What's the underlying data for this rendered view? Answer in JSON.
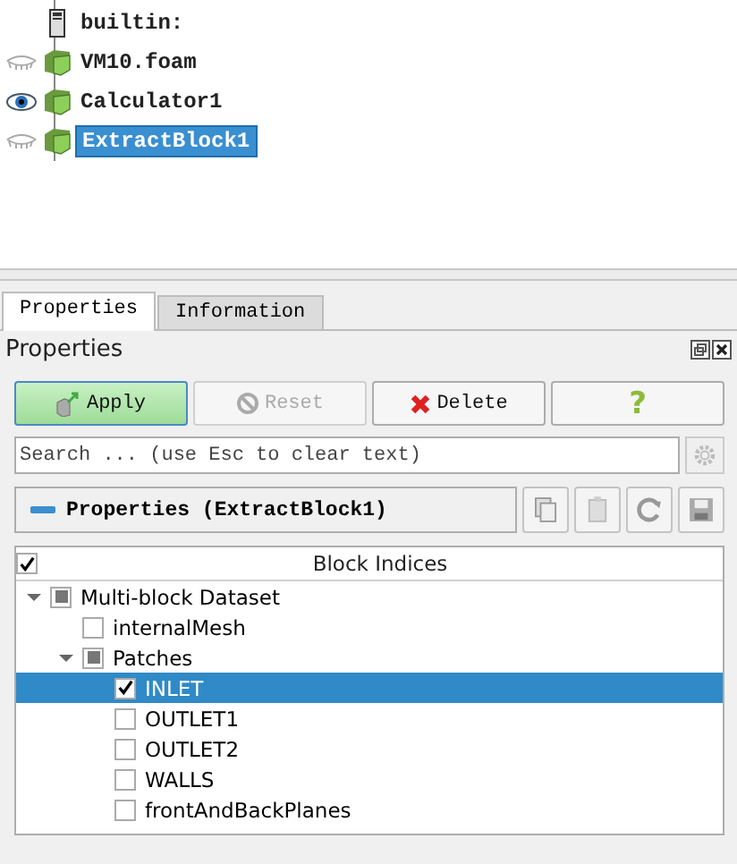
{
  "pipeline": [
    {
      "label": "builtin:",
      "kind": "server",
      "selected": false
    },
    {
      "label": "VM10.foam",
      "kind": "source",
      "visible": false,
      "selected": false
    },
    {
      "label": "Calculator1",
      "kind": "source",
      "visible": true,
      "selected": false
    },
    {
      "label": "ExtractBlock1",
      "kind": "source",
      "visible": false,
      "selected": true
    }
  ],
  "tabs": [
    {
      "label": "Properties",
      "selected": true
    },
    {
      "label": "Information",
      "selected": false
    }
  ],
  "panel_title": "Properties",
  "buttons": [
    {
      "label": "Apply",
      "kind": "apply",
      "disabled": false
    },
    {
      "label": "Reset",
      "kind": "reset",
      "disabled": true
    },
    {
      "label": "Delete",
      "kind": "delete",
      "disabled": false
    },
    {
      "label": "?",
      "kind": "help",
      "disabled": false
    }
  ],
  "search": {
    "placeholder": "Search ... (use Esc to clear text)"
  },
  "section": {
    "label": "Properties (ExtractBlock1)"
  },
  "block_tree": {
    "header": {
      "label": "Block Indices",
      "checked": true
    },
    "items": [
      {
        "label": "Multi-block Dataset",
        "checked": false,
        "partial": true,
        "expanded": true,
        "selected": false,
        "children": [
          {
            "label": "internalMesh",
            "checked": false,
            "partial": false,
            "selected": false
          },
          {
            "label": "Patches",
            "checked": false,
            "partial": true,
            "expanded": true,
            "selected": false,
            "children": [
              {
                "label": "INLET",
                "checked": true,
                "partial": false,
                "selected": true
              },
              {
                "label": "OUTLET1",
                "checked": false,
                "partial": false,
                "selected": false
              },
              {
                "label": "OUTLET2",
                "checked": false,
                "partial": false,
                "selected": false
              },
              {
                "label": "WALLS",
                "checked": false,
                "partial": false,
                "selected": false
              },
              {
                "label": "frontAndBackPlanes",
                "checked": false,
                "partial": false,
                "selected": false
              }
            ]
          }
        ]
      }
    ]
  }
}
